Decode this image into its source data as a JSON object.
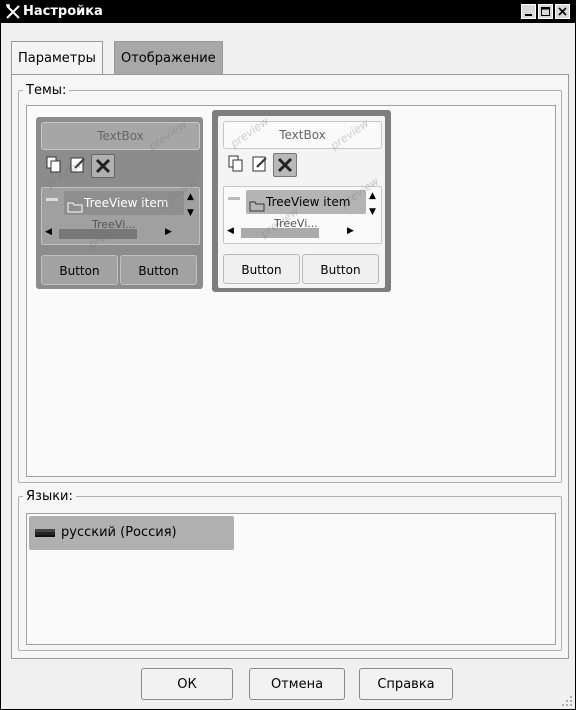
{
  "window": {
    "title": "Настройка",
    "controls": [
      "minimize-icon",
      "maximize-icon",
      "close-icon"
    ]
  },
  "tabs": [
    {
      "label": "Параметры",
      "active": false
    },
    {
      "label": "Отображение",
      "active": true
    }
  ],
  "themes": {
    "legend": "Темы:",
    "items": [
      {
        "textbox": "TextBox",
        "tree_item": "TreeView item",
        "tree_subitem": "TreeVi...",
        "button1": "Button",
        "button2": "Button",
        "watermark": "preview",
        "selected": false,
        "colors": {
          "frame": "#8c8c8c",
          "inner": "#9e9e9e",
          "text": "#000000"
        }
      },
      {
        "textbox": "TextBox",
        "tree_item": "TreeView item",
        "tree_subitem": "TreeVi...",
        "button1": "Button",
        "button2": "Button",
        "watermark": "preview",
        "selected": true,
        "colors": {
          "frame": "#7e7e7e",
          "inner": "#f4f4f4",
          "text": "#000000"
        }
      }
    ]
  },
  "languages": {
    "legend": "Языки:",
    "items": [
      {
        "label": "русский (Россия)",
        "selected": true,
        "icon": "russia-flag-icon"
      }
    ]
  },
  "buttons": {
    "ok": "ОК",
    "cancel": "Отмена",
    "help": "Справка"
  }
}
